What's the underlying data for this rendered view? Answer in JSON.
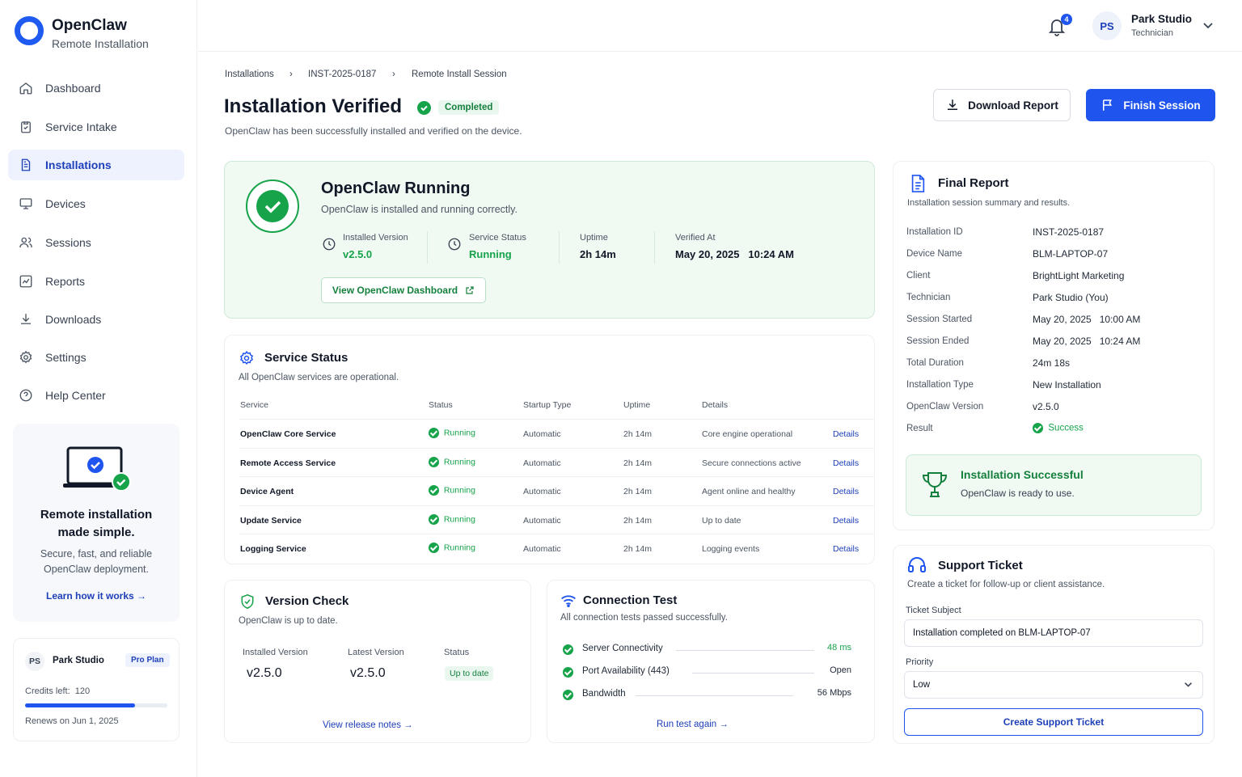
{
  "brand": {
    "title": "OpenClaw",
    "subtitle": "Remote Installation"
  },
  "nav": [
    {
      "label": "Dashboard",
      "icon": "home-icon",
      "active": false
    },
    {
      "label": "Service Intake",
      "icon": "clipboard-icon",
      "active": false
    },
    {
      "label": "Installations",
      "icon": "document-icon",
      "active": true
    },
    {
      "label": "Devices",
      "icon": "monitor-icon",
      "active": false
    },
    {
      "label": "Sessions",
      "icon": "users-icon",
      "active": false
    },
    {
      "label": "Reports",
      "icon": "chart-icon",
      "active": false
    },
    {
      "label": "Downloads",
      "icon": "download-icon",
      "active": false
    },
    {
      "label": "Settings",
      "icon": "gear-icon",
      "active": false
    },
    {
      "label": "Help Center",
      "icon": "help-icon",
      "active": false
    }
  ],
  "promo": {
    "title_line1": "Remote installation",
    "title_line2": "made simple.",
    "text_line1": "Secure, fast, and reliable",
    "text_line2": "OpenClaw deployment.",
    "link": "Learn how it works"
  },
  "plan": {
    "initials": "PS",
    "name": "Park Studio",
    "badge": "Pro Plan",
    "credits_label": "Credits left:",
    "credits_value": "120",
    "credits_fraction": 0.77,
    "renews": "Renews on Jun 1, 2025"
  },
  "topbar": {
    "notification_count": "4",
    "user_initials": "PS",
    "user_name": "Park Studio",
    "user_role": "Technician"
  },
  "breadcrumb": [
    "Installations",
    "INST-2025-0187",
    "Remote Install Session"
  ],
  "header": {
    "title": "Installation Verified",
    "status_badge": "Completed",
    "subtitle": "OpenClaw has been successfully installed and verified on the device.",
    "download_label": "Download Report",
    "finish_label": "Finish Session"
  },
  "running": {
    "title": "OpenClaw Running",
    "subtitle": "OpenClaw is installed and running correctly.",
    "installed_version_label": "Installed Version",
    "installed_version": "v2.5.0",
    "service_status_label": "Service Status",
    "service_status": "Running",
    "uptime_label": "Uptime",
    "uptime": "2h 14m",
    "verified_label": "Verified At",
    "verified_date": "May 20, 2025",
    "verified_time": "10:24 AM",
    "dashboard_link": "View OpenClaw Dashboard"
  },
  "service_status": {
    "title": "Service Status",
    "subtitle": "All OpenClaw services are operational.",
    "columns": [
      "Service",
      "Status",
      "Startup Type",
      "Uptime",
      "Details"
    ],
    "rows": [
      {
        "service": "OpenClaw Core Service",
        "status": "Running",
        "startup": "Automatic",
        "uptime": "2h 14m",
        "details": "Core engine operational",
        "link": "Details"
      },
      {
        "service": "Remote Access Service",
        "status": "Running",
        "startup": "Automatic",
        "uptime": "2h 14m",
        "details": "Secure connections active",
        "link": "Details"
      },
      {
        "service": "Device Agent",
        "status": "Running",
        "startup": "Automatic",
        "uptime": "2h 14m",
        "details": "Agent online and healthy",
        "link": "Details"
      },
      {
        "service": "Update Service",
        "status": "Running",
        "startup": "Automatic",
        "uptime": "2h 14m",
        "details": "Up to date",
        "link": "Details"
      },
      {
        "service": "Logging Service",
        "status": "Running",
        "startup": "Automatic",
        "uptime": "2h 14m",
        "details": "Logging events",
        "link": "Details"
      }
    ]
  },
  "version_check": {
    "title": "Version Check",
    "subtitle": "OpenClaw is up to date.",
    "installed_label": "Installed Version",
    "installed": "v2.5.0",
    "latest_label": "Latest Version",
    "latest": "v2.5.0",
    "status_label": "Status",
    "status": "Up to date",
    "link": "View release notes"
  },
  "connection_test": {
    "title": "Connection Test",
    "subtitle": "All connection tests passed successfully.",
    "items": [
      {
        "label": "Server Connectivity",
        "value": "48 ms"
      },
      {
        "label": "Port Availability (443)",
        "value": "Open"
      },
      {
        "label": "Bandwidth",
        "value": "56 Mbps"
      }
    ],
    "link": "Run test again"
  },
  "final_report": {
    "title": "Final Report",
    "subtitle": "Installation session summary and results.",
    "rows": [
      {
        "k": "Installation ID",
        "v": "INST-2025-0187"
      },
      {
        "k": "Device Name",
        "v": "BLM-LAPTOP-07"
      },
      {
        "k": "Client",
        "v": "BrightLight Marketing"
      },
      {
        "k": "Technician",
        "v": "Park Studio (You)"
      },
      {
        "k": "Session Started",
        "v": "May 20, 2025   10:00 AM"
      },
      {
        "k": "Session Ended",
        "v": "May 20, 2025   10:24 AM"
      },
      {
        "k": "Total Duration",
        "v": "24m 18s"
      },
      {
        "k": "Installation Type",
        "v": "New Installation"
      },
      {
        "k": "OpenClaw Version",
        "v": "v2.5.0"
      }
    ],
    "result_label": "Result",
    "result_value": "Success",
    "success_title": "Installation Successful",
    "success_text": "OpenClaw is ready to use."
  },
  "support": {
    "title": "Support Ticket",
    "subtitle": "Create a ticket for follow-up or client assistance.",
    "subject_label": "Ticket Subject",
    "subject_value": "Installation completed on BLM-LAPTOP-07",
    "priority_label": "Priority",
    "priority_value": "Low",
    "button": "Create Support Ticket"
  },
  "colors": {
    "primary": "#1f55ee",
    "success": "#16a34a",
    "success_bg": "#f0faf3"
  }
}
